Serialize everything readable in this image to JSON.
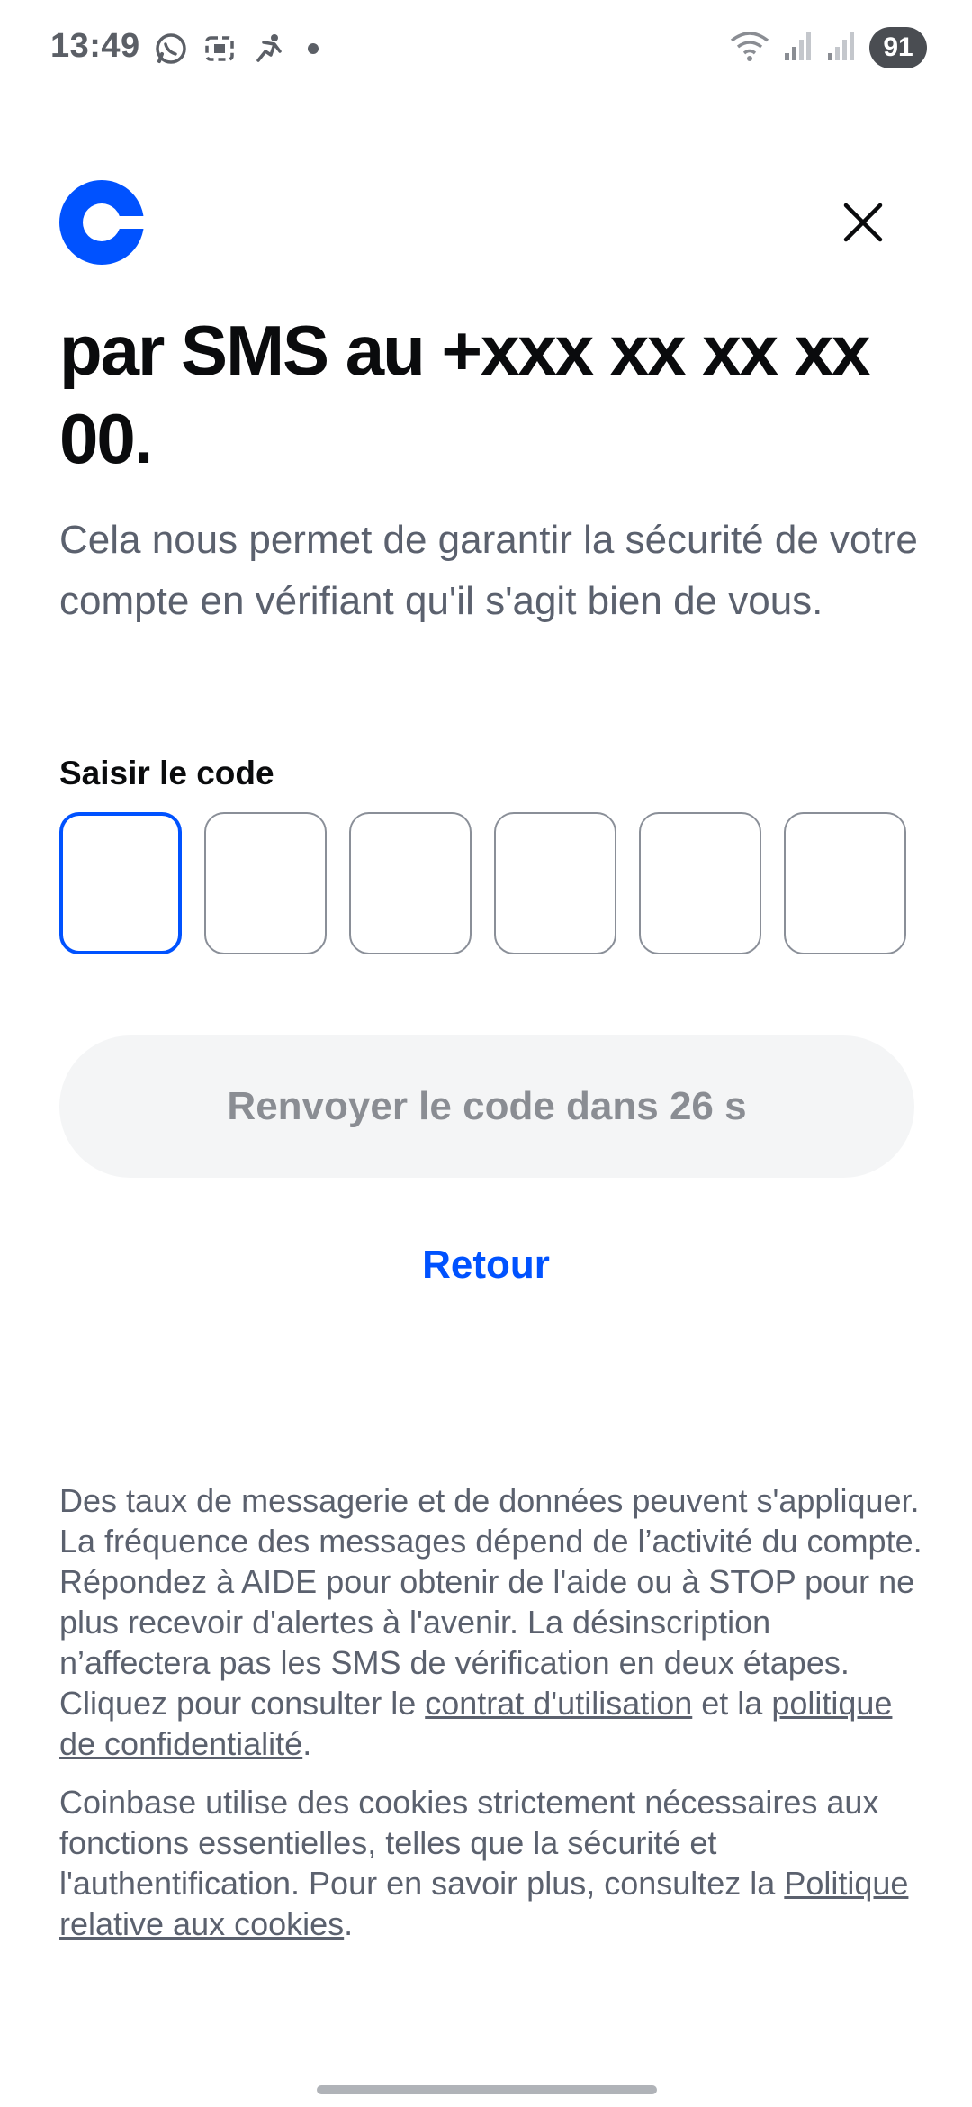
{
  "status_bar": {
    "time": "13:49",
    "battery": "91",
    "icons_left": [
      "whatsapp-icon",
      "screenshot-icon",
      "activity-icon"
    ],
    "icons_right": [
      "wifi-icon",
      "signal-icon",
      "signal-icon-2",
      "battery-icon"
    ]
  },
  "header": {
    "logo": "coinbase-logo",
    "close_icon": "close-icon",
    "brand_color": "#0052ff"
  },
  "main": {
    "headline": "par SMS au +xxx xx xx xx 00.",
    "subtitle": "Cela nous permet de garantir la sécurité de votre compte en vérifiant qu'il s'agit bien de vous.",
    "code_label": "Saisir le code",
    "code_digits": [
      "",
      "",
      "",
      "",
      "",
      ""
    ],
    "resend_label": "Renvoyer le code dans 26 s",
    "back_label": "Retour"
  },
  "legal": {
    "p1_text": "Des taux de messagerie et de données peuvent s'appliquer. La fréquence des messages dépend de l’activité du compte. Répondez à AIDE pour obtenir de l'aide ou à STOP pour ne plus recevoir d'alertes à l'avenir. La désinscription n’affectera pas les SMS de vérification en deux étapes. Cliquez pour consulter le ",
    "p1_link1": "contrat d'utilisation",
    "p1_mid": " et la ",
    "p1_link2": "politique de confidentialité",
    "p1_end": ".",
    "p2_text": "Coinbase utilise des cookies strictement nécessaires aux fonctions essentielles, telles que la sécurité et l'authentification. Pour en savoir plus, consultez la ",
    "p2_link": "Politique relative aux cookies",
    "p2_end": "."
  }
}
